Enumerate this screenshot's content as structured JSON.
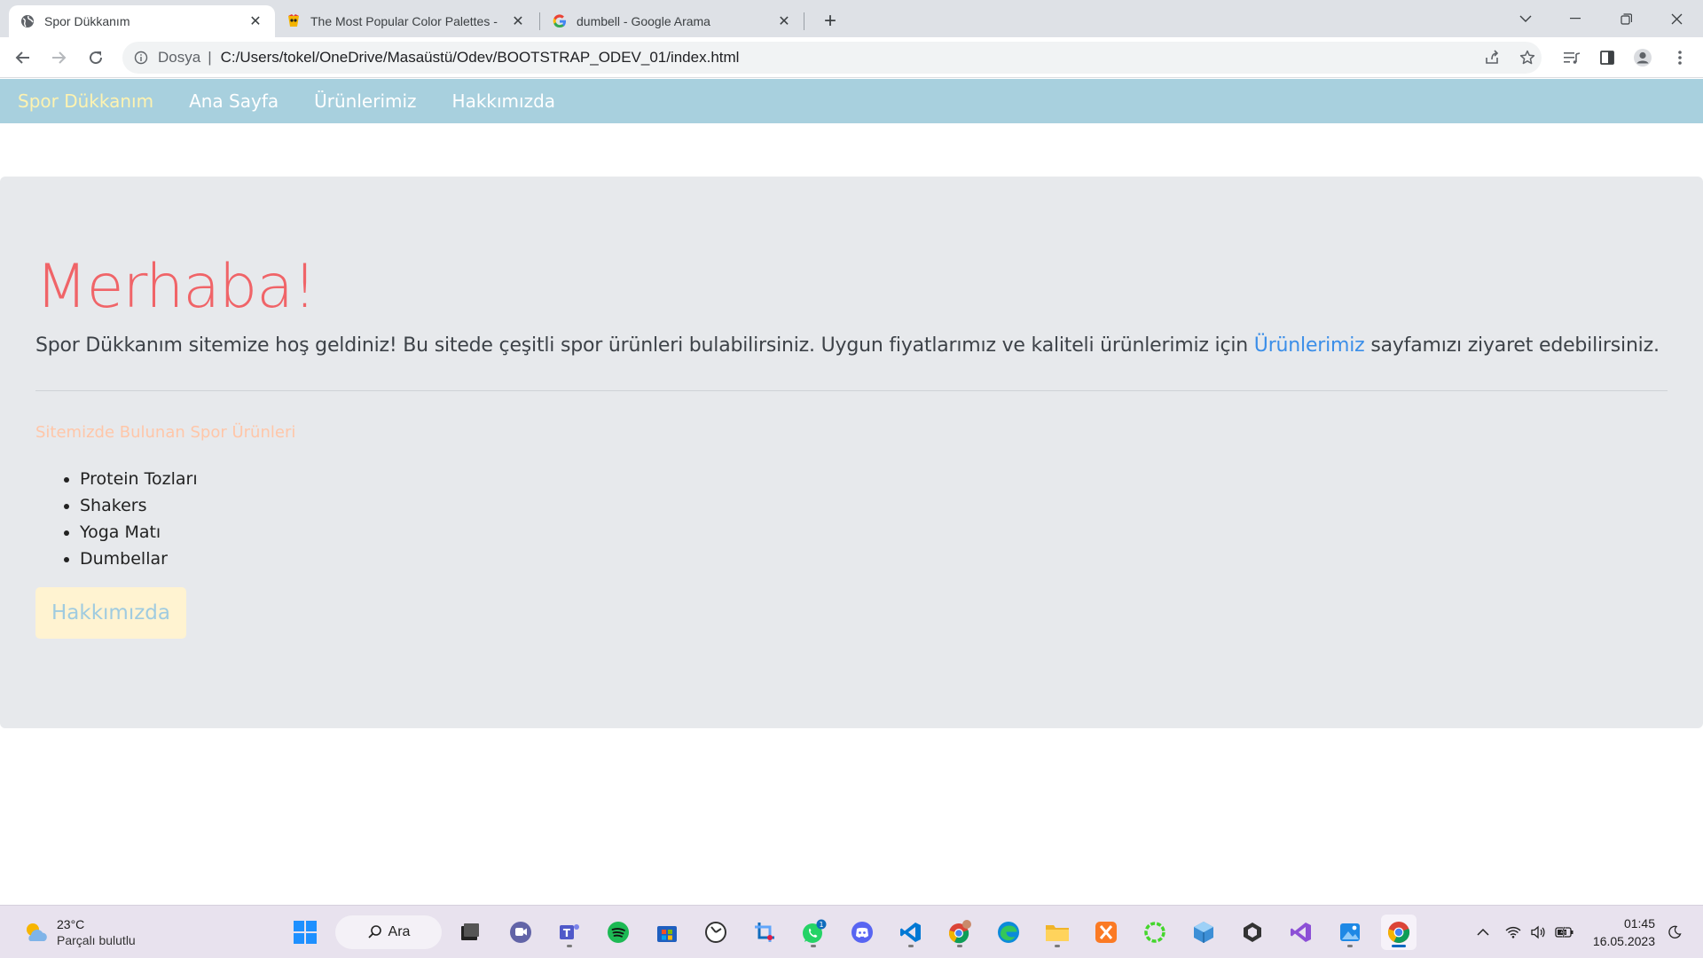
{
  "browser": {
    "tabs": [
      {
        "title": "Spor Dükkanım",
        "active": true,
        "favicon": "globe-icon"
      },
      {
        "title": "The Most Popular Color Palettes -",
        "active": false,
        "favicon": "coolors-icon"
      },
      {
        "title": "dumbell - Google Arama",
        "active": false,
        "favicon": "google-icon"
      }
    ],
    "address": {
      "scheme_label": "Dosya",
      "url": "C:/Users/tokel/OneDrive/Masaüstü/Odev/BOOTSTRAP_ODEV_01/index.html"
    }
  },
  "page": {
    "navbar": {
      "brand": "Spor Dükkanım",
      "links": [
        "Ana Sayfa",
        "Ürünlerimiz",
        "Hakkımızda"
      ]
    },
    "jumbotron": {
      "heading": "Merhaba!",
      "lead_before": "Spor Dükkanım sitemize hoş geldiniz! Bu sitede çeşitli spor ürünleri bulabilirsiniz. Uygun fiyatlarımız ve kaliteli ürünlerimiz için ",
      "lead_link": "Ürünlerimiz",
      "lead_after": " sayfamızı ziyaret edebilirsiniz.",
      "subtitle": "Sitemizde Bulunan Spor Ürünleri",
      "items": [
        "Protein Tozları",
        "Shakers",
        "Yoga Matı",
        "Dumbellar"
      ],
      "button": "Hakkımızda"
    },
    "colors": {
      "navbar_bg": "#a8d0de",
      "brand": "#fff3b0",
      "heading": "#f06468",
      "link": "#3b8ee8",
      "subtitle": "#ffc6a8",
      "button_bg": "#fff3d1",
      "button_text": "#9fcbe0"
    }
  },
  "taskbar": {
    "weather": {
      "temp": "23°C",
      "condition": "Parçalı bulutlu"
    },
    "search_label": "Ara",
    "whatsapp_badge": "1",
    "clock": {
      "time": "01:45",
      "date": "16.05.2023"
    }
  }
}
